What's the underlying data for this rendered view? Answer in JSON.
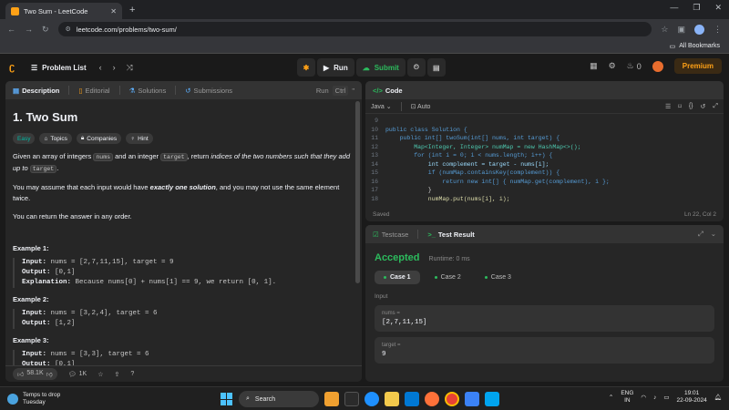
{
  "browser": {
    "tab_title": "Two Sum - LeetCode",
    "url": "leetcode.com/problems/two-sum/",
    "bookmarks_label": "All Bookmarks"
  },
  "nav": {
    "problem_list": "Problem List",
    "run": "Run",
    "submit": "Submit",
    "streak": "0",
    "premium": "Premium"
  },
  "description": {
    "tabs": [
      "Description",
      "Editorial",
      "Solutions",
      "Submissions"
    ],
    "run_hint": "Run",
    "run_key": "Ctrl",
    "title": "1. Two Sum",
    "difficulty": "Easy",
    "tag_topics": "Topics",
    "tag_companies": "Companies",
    "tag_hint": "Hint",
    "p1_a": "Given an array of integers",
    "p1_nums": "nums",
    "p1_b": "and an integer",
    "p1_target": "target",
    "p1_c": ", return",
    "p1_em": "indices of the two numbers such that they add up to",
    "p1_target2": "target",
    "p1_end": ".",
    "p2_a": "You may assume that each input would have",
    "p2_b": "exactly one solution",
    "p2_c": ", and you may not use the same element twice.",
    "p3": "You can return the answer in any order.",
    "examples": [
      {
        "h": "Example 1:",
        "input": "nums = [2,7,11,15], target = 9",
        "output": "[0,1]",
        "explanation": "Because nums[0] + nums[1] == 9, we return [0, 1]."
      },
      {
        "h": "Example 2:",
        "input": "nums = [3,2,4], target = 6",
        "output": "[1,2]"
      },
      {
        "h": "Example 3:",
        "input": "nums = [3,3], target = 6",
        "output": "[0,1]"
      }
    ],
    "input_label": "Input:",
    "output_label": "Output:",
    "explanation_label": "Explanation:",
    "likes": "58.1K",
    "comments": "1K"
  },
  "code": {
    "title": "Code",
    "language": "Java",
    "mode": "Auto",
    "lines": [
      {
        "n": "9",
        "t": ""
      },
      {
        "n": "10",
        "t": "public class Solution {"
      },
      {
        "n": "11",
        "t": "    public int[] twoSum(int[] nums, int target) {"
      },
      {
        "n": "12",
        "t": "        Map<Integer, Integer> numMap = new HashMap<>();"
      },
      {
        "n": "13",
        "t": "        for (int i = 0; i < nums.length; i++) {"
      },
      {
        "n": "14",
        "t": "            int complement = target - nums[i];"
      },
      {
        "n": "15",
        "t": "            if (numMap.containsKey(complement)) {"
      },
      {
        "n": "16",
        "t": "                return new int[] { numMap.get(complement), i };"
      },
      {
        "n": "17",
        "t": "            }"
      },
      {
        "n": "18",
        "t": "            numMap.put(nums[i], i);"
      }
    ],
    "saved": "Saved",
    "cursor": "Ln 22, Col 2"
  },
  "tests": {
    "tab_testcase": "Testcase",
    "tab_result": "Test Result",
    "status": "Accepted",
    "runtime": "Runtime: 0 ms",
    "cases": [
      "Case 1",
      "Case 2",
      "Case 3"
    ],
    "input_label": "Input",
    "nums_label": "nums =",
    "nums_value": "[2,7,11,15]",
    "target_label": "target =",
    "target_value": "9"
  },
  "taskbar": {
    "weather_1": "Temps to drop",
    "weather_2": "Tuesday",
    "search": "Search",
    "lang_1": "ENG",
    "lang_2": "IN",
    "time": "19:01",
    "date": "22-09-2024"
  }
}
